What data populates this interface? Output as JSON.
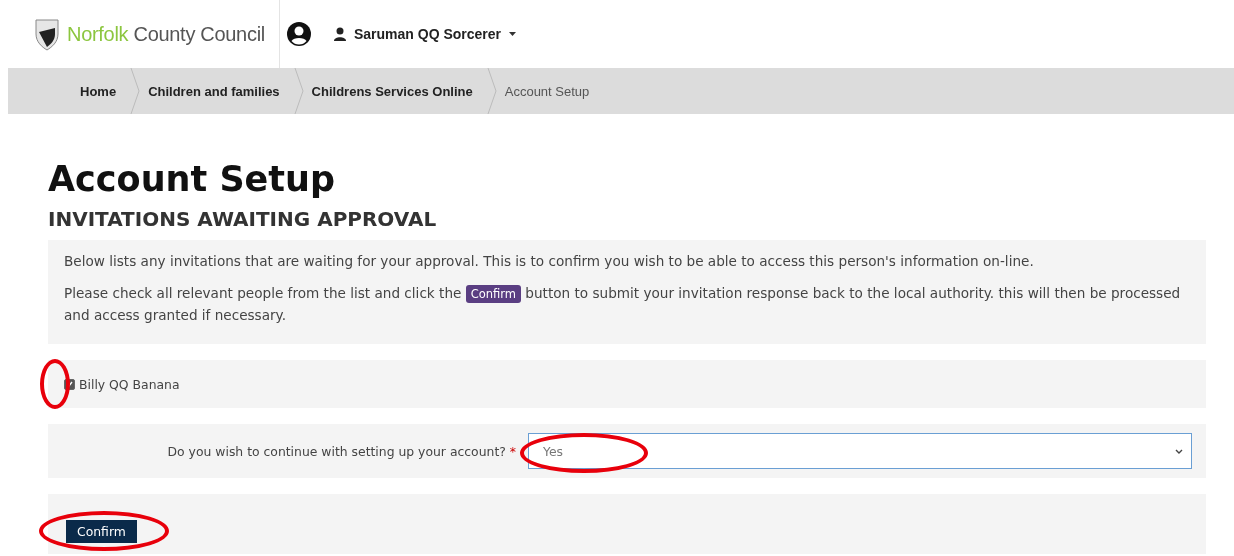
{
  "header": {
    "logo_text": {
      "accent": "Norfolk",
      "rest": "County Council"
    },
    "user_name": "Saruman QQ Sorcerer"
  },
  "breadcrumb": [
    {
      "label": "Home",
      "current": false
    },
    {
      "label": "Children and families",
      "current": false
    },
    {
      "label": "Childrens Services Online",
      "current": false
    },
    {
      "label": "Account Setup",
      "current": true
    }
  ],
  "page_title": "Account Setup",
  "section_title": "INVITATIONS AWAITING APPROVAL",
  "info": {
    "line_1": "Below lists any invitations that are waiting for your approval. This is to confirm you wish to be able to access this person's information on-line.",
    "line_2_before": "Please check all relevant people from the list and click the",
    "inline_button": "Confirm",
    "line_2_after": "button to submit your invitation response back to the local authority. this will then be processed and access granted if necessary."
  },
  "invitations": [
    {
      "name": "Billy QQ Banana",
      "checked": true,
      "circled": true
    }
  ],
  "question": {
    "label": "Do you wish to continue with setting up your account?",
    "required_mark": "*",
    "value": "Yes",
    "circled": true
  },
  "confirm_button": {
    "label": "Confirm",
    "circled": true
  }
}
